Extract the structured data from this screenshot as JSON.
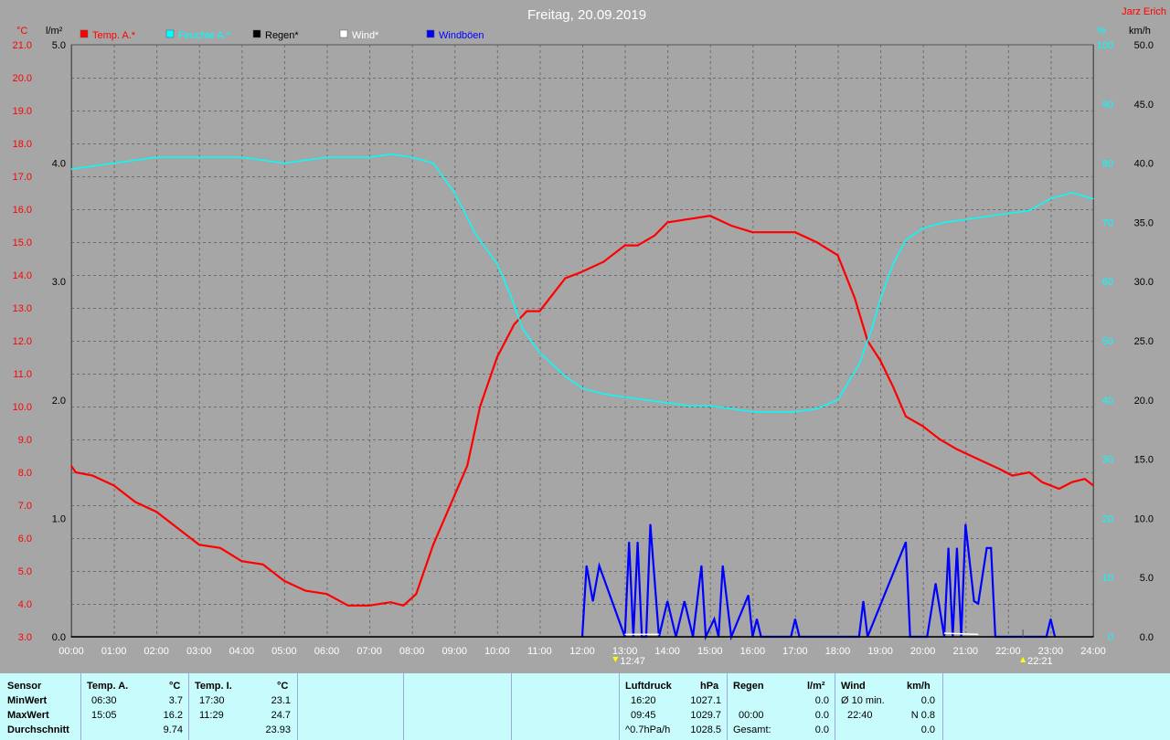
{
  "header": {
    "title": "Freitag, 20.09.2019",
    "author": "Jarz Erich"
  },
  "units": {
    "left1": "°C",
    "left2": "l/m²",
    "right1": "%",
    "right2": "km/h"
  },
  "legend": [
    {
      "label": "Temp. A.*",
      "color": "#ff0000"
    },
    {
      "label": "Feuchte A.*",
      "color": "#00ffff"
    },
    {
      "label": "Regen*",
      "color": "#000000"
    },
    {
      "label": "Wind*",
      "color": "#ffffff"
    },
    {
      "label": "Windböen",
      "color": "#0000ff"
    }
  ],
  "events": {
    "sunrise": "12:47",
    "sunset": "22:21"
  },
  "chart_data": {
    "type": "line",
    "x_ticks": [
      "00:00",
      "01:00",
      "02:00",
      "03:00",
      "04:00",
      "05:00",
      "06:00",
      "07:00",
      "08:00",
      "09:00",
      "10:00",
      "11:00",
      "12:00",
      "13:00",
      "14:00",
      "15:00",
      "16:00",
      "17:00",
      "18:00",
      "19:00",
      "20:00",
      "21:00",
      "22:00",
      "23:00",
      "24:00"
    ],
    "axes": {
      "temp": {
        "min": 3.0,
        "max": 21.0,
        "ticks": [
          "3.0",
          "4.0",
          "5.0",
          "6.0",
          "7.0",
          "8.0",
          "9.0",
          "10.0",
          "11.0",
          "12.0",
          "13.0",
          "14.0",
          "15.0",
          "16.0",
          "17.0",
          "18.0",
          "19.0",
          "20.0",
          "21.0"
        ]
      },
      "rain": {
        "min": 0.0,
        "max": 5.0,
        "ticks": [
          "0.0",
          "1.0",
          "2.0",
          "3.0",
          "4.0",
          "5.0"
        ]
      },
      "humidity": {
        "min": 0,
        "max": 100,
        "ticks": [
          "0",
          "10",
          "20",
          "30",
          "40",
          "50",
          "60",
          "70",
          "80",
          "90",
          "100"
        ]
      },
      "wind": {
        "min": 0.0,
        "max": 50.0,
        "ticks": [
          "0.0",
          "5.0",
          "10.0",
          "15.0",
          "20.0",
          "25.0",
          "30.0",
          "35.0",
          "40.0",
          "45.0",
          "50.0"
        ]
      }
    },
    "series": [
      {
        "name": "Temp. A.*",
        "axis": "temp",
        "color": "#ff0000",
        "x": [
          0,
          0.1,
          0.5,
          1,
          1.5,
          2,
          2.5,
          3,
          3.5,
          4,
          4.5,
          5,
          5.5,
          6,
          6.5,
          7,
          7.5,
          7.8,
          8.1,
          8.5,
          9,
          9.3,
          9.6,
          10,
          10.4,
          10.7,
          11,
          11.3,
          11.6,
          12,
          12.5,
          13,
          13.3,
          13.7,
          14,
          14.5,
          15,
          15.5,
          16,
          16.5,
          17,
          17.5,
          18,
          18.4,
          18.7,
          19,
          19.3,
          19.6,
          20,
          20.4,
          20.8,
          21.3,
          21.8,
          22.1,
          22.5,
          22.8,
          23.2,
          23.5,
          23.8,
          24
        ],
        "y": [
          8.2,
          8.0,
          7.9,
          7.6,
          7.1,
          6.8,
          6.3,
          5.8,
          5.7,
          5.3,
          5.2,
          4.7,
          4.4,
          4.3,
          3.95,
          3.95,
          4.05,
          3.95,
          4.3,
          5.8,
          7.3,
          8.2,
          10.0,
          11.5,
          12.5,
          12.9,
          12.9,
          13.4,
          13.9,
          14.1,
          14.4,
          14.9,
          14.9,
          15.2,
          15.6,
          15.7,
          15.8,
          15.5,
          15.3,
          15.3,
          15.3,
          15.0,
          14.6,
          13.3,
          12.0,
          11.4,
          10.6,
          9.7,
          9.4,
          9.0,
          8.7,
          8.4,
          8.1,
          7.9,
          8.0,
          7.7,
          7.5,
          7.7,
          7.8,
          7.6
        ]
      },
      {
        "name": "Feuchte A.*",
        "axis": "humidity",
        "color": "#00ffff",
        "x": [
          0,
          1,
          2,
          3,
          4,
          5,
          6,
          6.5,
          7,
          7.5,
          8,
          8.5,
          9,
          9.5,
          10,
          10.3,
          10.6,
          11,
          11.3,
          11.6,
          12,
          12.5,
          13,
          13.5,
          14,
          14.5,
          15,
          15.5,
          16,
          16.5,
          17,
          17.5,
          18,
          18.5,
          18.8,
          19,
          19.3,
          19.6,
          20,
          20.5,
          21,
          21.5,
          22,
          22.5,
          23,
          23.5,
          24
        ],
        "y": [
          79,
          80,
          81,
          81,
          81,
          80,
          81,
          81,
          81,
          81.5,
          81,
          80,
          75,
          68,
          63,
          58,
          52,
          48,
          46,
          44,
          42,
          41,
          40.5,
          40,
          39.5,
          39,
          39,
          38.5,
          38,
          38,
          38,
          38.5,
          40,
          46,
          52,
          57,
          63,
          67,
          69,
          70,
          70.5,
          71,
          71.5,
          72,
          74,
          75,
          74
        ]
      },
      {
        "name": "Windböen",
        "axis": "wind",
        "color": "#0000ff",
        "type": "bar-impulse",
        "x": [
          12.0,
          12.1,
          12.25,
          12.4,
          13.0,
          13.1,
          13.2,
          13.3,
          13.4,
          13.5,
          13.6,
          13.8,
          14.0,
          14.2,
          14.4,
          14.6,
          14.8,
          14.9,
          15.1,
          15.2,
          15.3,
          15.5,
          15.9,
          16.0,
          16.1,
          16.2,
          16.9,
          17.0,
          17.1,
          18.5,
          18.6,
          18.7,
          19.6,
          19.7,
          20.1,
          20.3,
          20.5,
          20.6,
          20.7,
          20.8,
          20.9,
          21.0,
          21.2,
          21.3,
          21.5,
          21.6,
          21.7,
          22.9,
          23.0,
          23.1
        ],
        "y": [
          0,
          6,
          3,
          6,
          0,
          8,
          0,
          8,
          0,
          0,
          9.5,
          0,
          3,
          0,
          3,
          0,
          6,
          0,
          1.5,
          0,
          6,
          0,
          3.5,
          0,
          1.5,
          0,
          0,
          1.5,
          0,
          0,
          3,
          0,
          8,
          0,
          0,
          4.5,
          0,
          7.5,
          0,
          7.5,
          0,
          9.5,
          3,
          2.8,
          7.5,
          7.5,
          0,
          0,
          1.5,
          0
        ]
      },
      {
        "name": "Wind*",
        "axis": "wind",
        "color": "#ffffff",
        "type": "baseline",
        "x": [
          13.0,
          13.8,
          20.5,
          21.3
        ],
        "y": [
          0.2,
          0.2,
          0.3,
          0.2
        ]
      },
      {
        "name": "Regen*",
        "axis": "rain",
        "color": "#000000",
        "x": [
          0,
          24
        ],
        "y": [
          0,
          0
        ]
      }
    ]
  },
  "table": {
    "sensor": {
      "title": "Sensor",
      "rows": [
        "MinWert",
        "MaxWert",
        "Durchschnitt"
      ]
    },
    "temp_a": {
      "title": "Temp. A.",
      "unit": "°C",
      "min_time": "06:30",
      "min_val": "3.7",
      "max_time": "15:05",
      "max_val": "16.2",
      "avg": "9.74"
    },
    "temp_i": {
      "title": "Temp. I.",
      "unit": "°C",
      "min_time": "17:30",
      "min_val": "23.1",
      "max_time": "11:29",
      "max_val": "24.7",
      "avg": "23.93"
    },
    "pressure": {
      "title": "Luftdruck",
      "unit": "hPa",
      "min_time": "16:20",
      "min_val": "1027.1",
      "max_time": "09:45",
      "max_val": "1029.7",
      "avg_label": "^0.7hPa/h",
      "avg": "1028.5"
    },
    "rain": {
      "title": "Regen",
      "unit": "l/m²",
      "max_time": "00:00",
      "max_val": "0.0",
      "total_label": "Gesamt:",
      "total": "0.0",
      "min_val": "0.0"
    },
    "wind": {
      "title": "Wind",
      "unit": "km/h",
      "label1": "Ø 10 min.",
      "val1": "0.0",
      "time2": "22:40",
      "val2": "N 0.8",
      "avg": "0.0"
    }
  }
}
